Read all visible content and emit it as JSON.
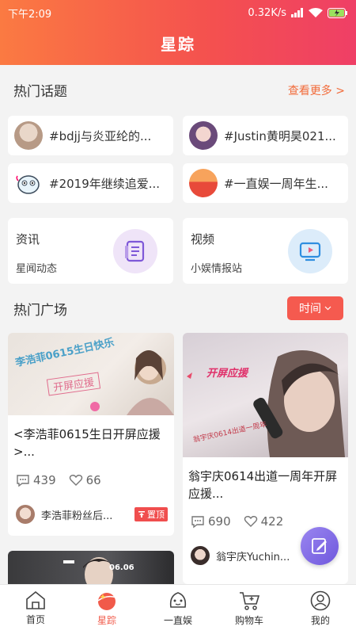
{
  "status": {
    "time": "下午2:09",
    "speed": "0.32K/s"
  },
  "header": {
    "title": "星踪"
  },
  "topics_section": {
    "title": "热门话题",
    "more": "查看更多 >"
  },
  "topics": [
    "#bdjj与炎亚纶的...",
    "#Justin黄明昊021...",
    "#2019年继续追爱...",
    "#一直娱一周年生..."
  ],
  "features": [
    {
      "title": "资讯",
      "sub": "星闻动态",
      "icon": "news-icon"
    },
    {
      "title": "视频",
      "sub": "小娱情报站",
      "icon": "tv-play-icon"
    }
  ],
  "plaza": {
    "title": "热门广场",
    "sort_label": "时间"
  },
  "cards": [
    {
      "title": "<李浩菲0615生日开屏应援>...",
      "comments": "439",
      "likes": "66",
      "author": "李浩菲粉丝后...",
      "pin": "置顶",
      "img_text": "李浩菲0615生日快乐",
      "img_text2": "开屏应援"
    },
    {
      "title": "翁宇庆0614出道一周年开屏应援...",
      "comments": "690",
      "likes": "422",
      "author": "翁宇庆Yuchin...",
      "img_text": "开屏应援",
      "img_text2": "翁宇庆0614出道一周年"
    },
    {
      "img_text": "06.06"
    }
  ],
  "tabs": [
    {
      "label": "首页",
      "icon": "home-icon"
    },
    {
      "label": "星踪",
      "icon": "star-planet-icon"
    },
    {
      "label": "一直娱",
      "icon": "mascot-icon"
    },
    {
      "label": "购物车",
      "icon": "cart-icon"
    },
    {
      "label": "我的",
      "icon": "profile-icon"
    }
  ],
  "colors": {
    "accent": "#f15a4a",
    "header_start": "#fb7a42",
    "header_end": "#ef3f66",
    "fab": "#7a63e2"
  }
}
